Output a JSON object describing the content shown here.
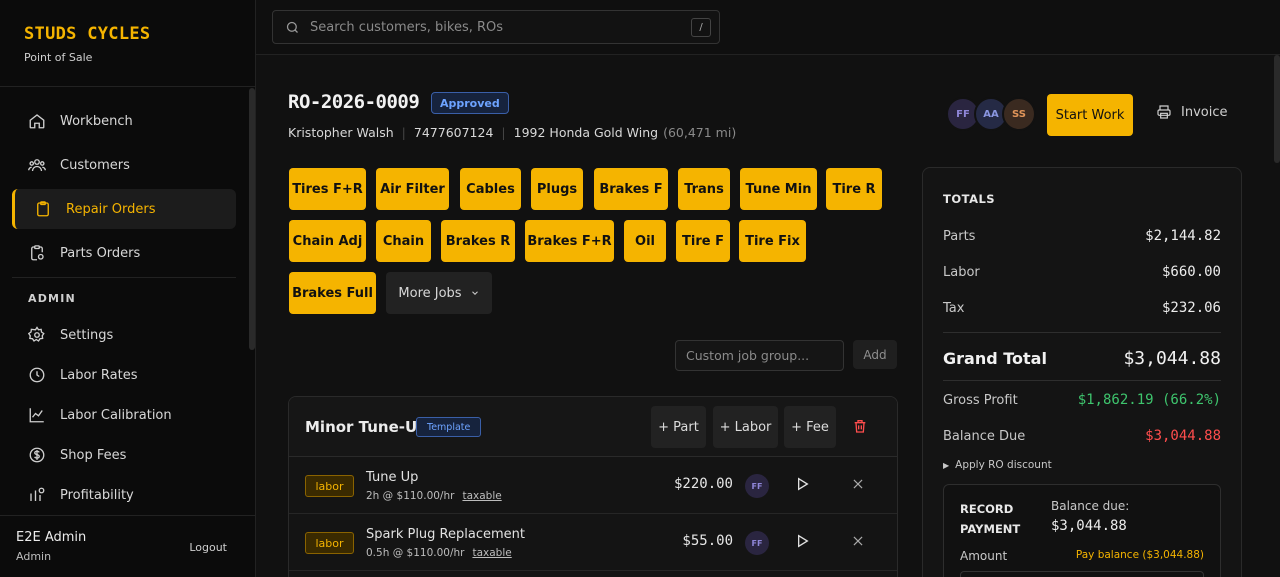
{
  "brand": {
    "name": "STUDS CYCLES",
    "subtitle": "Point of Sale"
  },
  "sidebar": {
    "items": [
      {
        "label": "Workbench",
        "icon": "home-icon",
        "active": false
      },
      {
        "label": "Customers",
        "icon": "users-icon",
        "active": false
      },
      {
        "label": "Repair Orders",
        "icon": "clipboard-icon",
        "active": true
      },
      {
        "label": "Parts Orders",
        "icon": "parts-clipboard-icon",
        "active": false
      }
    ],
    "admin_label": "ADMIN",
    "admin_items": [
      {
        "label": "Settings",
        "icon": "gear-icon"
      },
      {
        "label": "Labor Rates",
        "icon": "clock-icon"
      },
      {
        "label": "Labor Calibration",
        "icon": "chart-line-icon"
      },
      {
        "label": "Shop Fees",
        "icon": "dollar-circle-icon"
      },
      {
        "label": "Profitability",
        "icon": "profit-icon"
      }
    ]
  },
  "user": {
    "name": "E2E Admin",
    "role": "Admin",
    "logout": "Logout"
  },
  "search": {
    "placeholder": "Search customers, bikes, ROs",
    "shortcut": "/"
  },
  "ro": {
    "number": "RO-2026-0009",
    "status": "Approved",
    "customer": "Kristopher Walsh",
    "phone": "7477607124",
    "bike": "1992 Honda Gold Wing",
    "mileage": "(60,471 mi)"
  },
  "assignees": [
    {
      "initials": "FF",
      "bg": "#2a2540",
      "fg": "#8f86d8"
    },
    {
      "initials": "AA",
      "bg": "#252a45",
      "fg": "#8a96e0"
    },
    {
      "initials": "SS",
      "bg": "#3a2a20",
      "fg": "#e0955a"
    }
  ],
  "actions": {
    "start_work": "Start Work",
    "invoice": "Invoice"
  },
  "quick_jobs": [
    "Tires F+R",
    "Air Filter",
    "Cables",
    "Plugs",
    "Brakes F",
    "Trans",
    "Tune Min",
    "Tire R",
    "Chain Adj",
    "Chain",
    "Brakes R",
    "Brakes F+R",
    "Oil",
    "Tire F",
    "Tire Fix",
    "Brakes Full"
  ],
  "more_jobs": "More Jobs",
  "custom_group": {
    "placeholder": "Custom job group...",
    "add": "Add"
  },
  "job_group": {
    "title": "Minor Tune-Up",
    "badge": "Template",
    "add_part": "+ Part",
    "add_labor": "+ Labor",
    "add_fee": "+ Fee",
    "lines": [
      {
        "type": "labor",
        "name": "Tune Up",
        "detail": "2h @ $110.00/hr",
        "tax": "taxable",
        "price": "$220.00",
        "tech": "FF"
      },
      {
        "type": "labor",
        "name": "Spark Plug Replacement",
        "detail": "0.5h @ $110.00/hr",
        "tax": "taxable",
        "price": "$55.00",
        "tech": "FF"
      }
    ]
  },
  "totals": {
    "heading": "TOTALS",
    "parts_label": "Parts",
    "parts": "$2,144.82",
    "labor_label": "Labor",
    "labor": "$660.00",
    "tax_label": "Tax",
    "tax": "$232.06",
    "grand_label": "Grand Total",
    "grand": "$3,044.88",
    "profit_label": "Gross Profit",
    "profit": "$1,862.19 (66.2%)",
    "balance_label": "Balance Due",
    "balance": "$3,044.88",
    "discount": "Apply RO discount"
  },
  "payment": {
    "title": "RECORD PAYMENT",
    "balance_label": "Balance due:",
    "balance": "$3,044.88",
    "amount_label": "Amount",
    "pay_link": "Pay balance ($3,044.88)"
  },
  "colors": {
    "accent": "#f5b400",
    "approved": "#6da3ff",
    "profit": "#3ec46d",
    "due": "#ff4d4d"
  }
}
